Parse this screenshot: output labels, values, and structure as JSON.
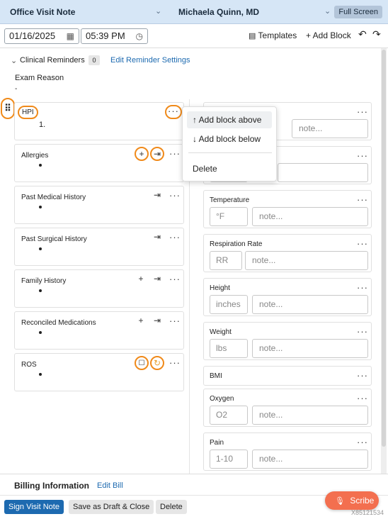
{
  "header": {
    "note_type": "Office Visit Note",
    "patient": "Michaela Quinn, MD",
    "full_screen": "Full Screen"
  },
  "toolbar": {
    "date": "01/16/2025",
    "time": "05:39 PM",
    "templates": "Templates",
    "add_block": "+ Add Block",
    "undo": "↶",
    "redo": "↷"
  },
  "reminders": {
    "label": "Clinical Reminders",
    "count": "0",
    "edit": "Edit Reminder Settings"
  },
  "exam_reason": {
    "label": "Exam Reason",
    "value": "-"
  },
  "left_blocks": [
    {
      "title": "HPI",
      "content": "1."
    },
    {
      "title": "Allergies"
    },
    {
      "title": "Past Medical History"
    },
    {
      "title": "Past Surgical History"
    },
    {
      "title": "Family History"
    },
    {
      "title": "Reconciled Medications"
    },
    {
      "title": "ROS"
    }
  ],
  "vitals": [
    {
      "title": "",
      "unit": "",
      "note": "note..."
    },
    {
      "title": "",
      "unit": "",
      "note": ""
    },
    {
      "title": "Temperature",
      "unit": "°F",
      "note": "note..."
    },
    {
      "title": "Respiration Rate",
      "unit": "RR",
      "note": "note..."
    },
    {
      "title": "Height",
      "unit": "inches",
      "note": "note..."
    },
    {
      "title": "Weight",
      "unit": "lbs",
      "note": "note..."
    },
    {
      "title": "BMI"
    },
    {
      "title": "Oxygen",
      "unit": "O2",
      "note": "note..."
    },
    {
      "title": "Pain",
      "unit": "1-10",
      "note": "note..."
    }
  ],
  "context_menu": {
    "add_above": "↑ Add block above",
    "add_below": "↓ Add block below",
    "delete": "Delete"
  },
  "billing": {
    "label": "Billing Information",
    "edit": "Edit Bill"
  },
  "actions": {
    "sign": "Sign Visit Note",
    "draft": "Save as Draft & Close",
    "delete": "Delete"
  },
  "scribe": {
    "label": "Scribe",
    "id_text": "X85121534"
  },
  "colors": {
    "header_bg": "#d6e6f6",
    "accent": "#1d6ab0",
    "highlight": "#f08a1a",
    "scribe": "#f36f4f"
  }
}
